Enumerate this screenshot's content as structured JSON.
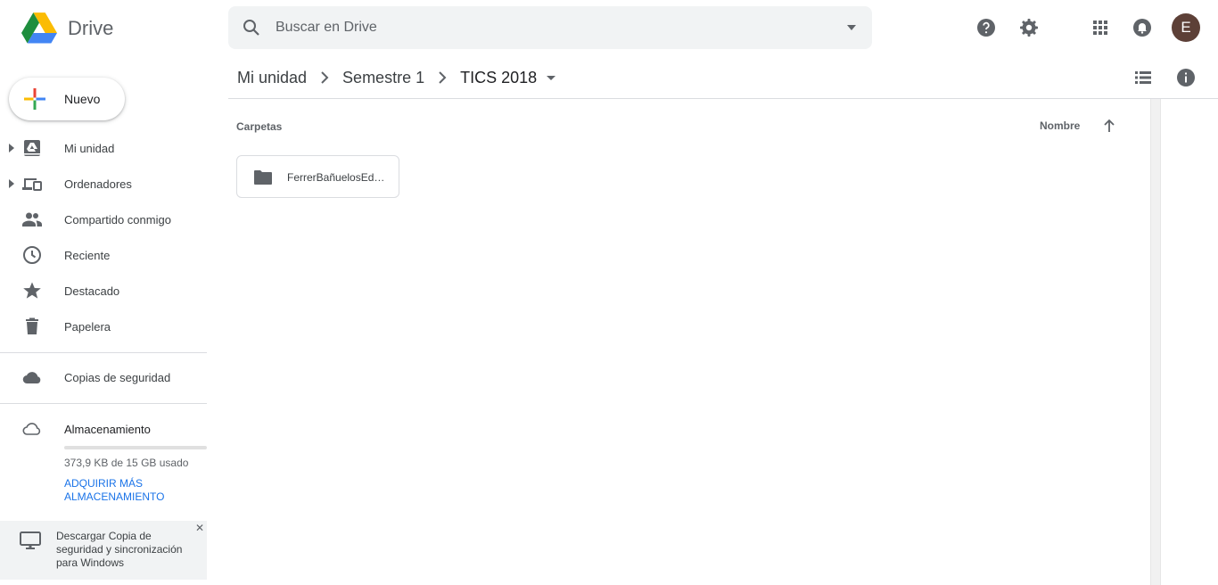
{
  "app": {
    "name": "Drive",
    "logo_icon": "google-drive-logo",
    "colors": {
      "drive_yellow": "#fbbc04",
      "drive_green": "#1e8e3e",
      "drive_blue": "#4285f4",
      "link": "#1a73e8",
      "avatar_bg": "#5d4037"
    }
  },
  "search": {
    "placeholder": "Buscar en Drive",
    "value": "",
    "options_icon": "arrow-drop-down-icon"
  },
  "header_icons": [
    "help-icon",
    "settings-icon",
    "apps-grid-icon",
    "notifications-icon"
  ],
  "user": {
    "avatar_initial": "E"
  },
  "sidebar": {
    "new_button": {
      "label": "Nuevo",
      "icon": "plus-multicolor-icon"
    },
    "items": [
      {
        "label": "Mi unidad",
        "icon": "my-drive-icon",
        "expandable": true
      },
      {
        "label": "Ordenadores",
        "icon": "computers-icon",
        "expandable": true
      },
      {
        "label": "Compartido conmigo",
        "icon": "people-icon",
        "expandable": false
      },
      {
        "label": "Reciente",
        "icon": "clock-icon",
        "expandable": false
      },
      {
        "label": "Destacado",
        "icon": "star-icon",
        "expandable": false
      },
      {
        "label": "Papelera",
        "icon": "trash-icon",
        "expandable": false
      }
    ],
    "backup": {
      "label": "Copias de seguridad",
      "icon": "cloud-icon"
    },
    "storage": {
      "label": "Almacenamiento",
      "icon": "cloud-outline-icon",
      "used_text": "373,9 KB de 15 GB usado",
      "used_fraction": 0.0,
      "upgrade_link": "ADQUIRIR MÁS ALMACENAMIENTO"
    },
    "promo": {
      "text": "Descargar Copia de seguridad y sincronización para Windows",
      "icon": "desktop-computer-icon",
      "close_icon": "close-icon"
    }
  },
  "main": {
    "breadcrumbs": [
      "Mi unidad",
      "Semestre 1",
      "TICS 2018"
    ],
    "view_icons": [
      "list-view-icon",
      "info-icon"
    ],
    "section_title": "Carpetas",
    "sort": {
      "label": "Nombre",
      "direction": "ascending",
      "icon": "arrow-up-icon"
    },
    "folders": [
      {
        "name": "FerrerBañuelosEd…",
        "icon": "folder-icon"
      }
    ]
  }
}
